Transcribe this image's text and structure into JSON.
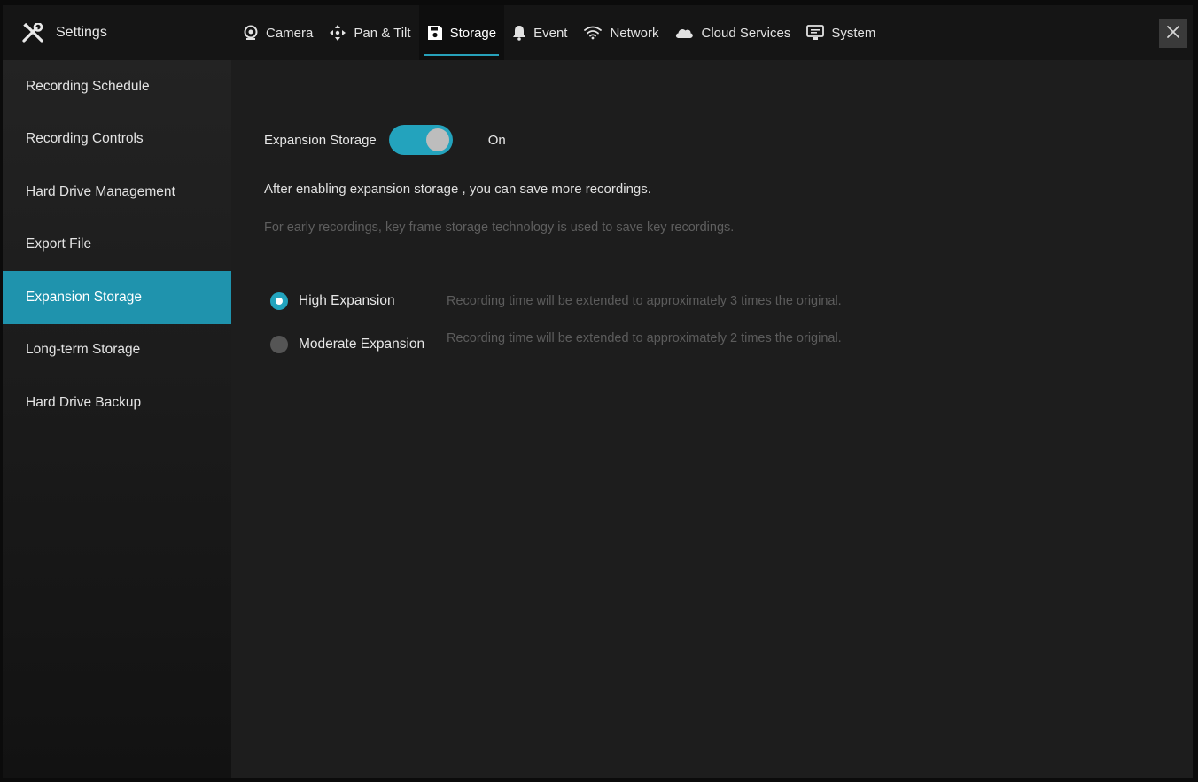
{
  "header": {
    "title": "Settings",
    "tabs": [
      {
        "label": "Camera",
        "icon": "camera-icon"
      },
      {
        "label": "Pan & Tilt",
        "icon": "pan-tilt-icon"
      },
      {
        "label": "Storage",
        "icon": "floppy-icon",
        "active": true
      },
      {
        "label": "Event",
        "icon": "bell-icon"
      },
      {
        "label": "Network",
        "icon": "wifi-icon"
      },
      {
        "label": "Cloud Services",
        "icon": "cloud-icon"
      },
      {
        "label": "System",
        "icon": "monitor-icon"
      }
    ],
    "close_icon": "close-icon"
  },
  "sidebar": {
    "items": [
      {
        "label": "Recording Schedule"
      },
      {
        "label": "Recording Controls"
      },
      {
        "label": "Hard Drive Management"
      },
      {
        "label": "Export File"
      },
      {
        "label": "Expansion Storage",
        "active": true
      },
      {
        "label": "Long-term Storage"
      },
      {
        "label": "Hard Drive Backup"
      }
    ]
  },
  "main": {
    "toggle": {
      "label": "Expansion Storage",
      "state": "On"
    },
    "description": "After enabling expansion storage , you can save more recordings.",
    "note": "For early recordings, key frame storage technology is used to save key recordings.",
    "options": [
      {
        "label": "High Expansion",
        "description": "Recording time will be extended to approximately 3 times the original.",
        "selected": true
      },
      {
        "label": "Moderate Expansion",
        "description": "Recording time will be extended to approximately 2 times the original.",
        "selected": false
      }
    ]
  },
  "colors": {
    "accent": "#23a3bd",
    "background": "#1d1d1d",
    "sidebar_active": "#1f93ad"
  }
}
